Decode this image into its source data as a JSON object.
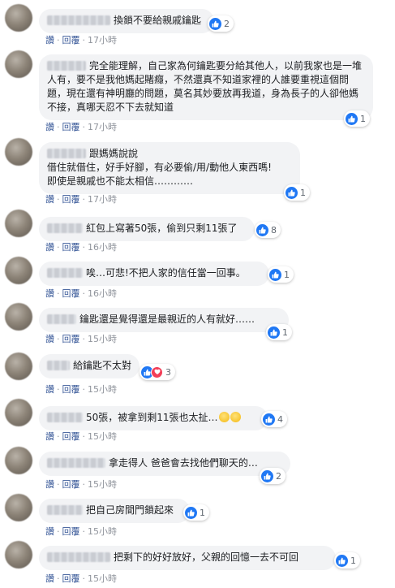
{
  "labels": {
    "like": "讚",
    "reply": "回覆",
    "separator": "·"
  },
  "colors": {
    "link": "#385898",
    "like": "#2078f4",
    "love": "#f33e58",
    "bubble": "#f2f3f5"
  },
  "comments": [
    {
      "text": "換鎖不要給親戚鑰匙",
      "reactions": "2",
      "time": "17小時",
      "emoji": []
    },
    {
      "text": "完全能理解，自己家為何鑰匙要分給其他人，以前我家也是一堆人有，要不是我他媽起賭癮，不然還真不知道家裡的人誰要重視這個問題，現在還有神明廳的問題，莫名其妙要放再我道，身為長子的人卻他媽不接，真哪天忍不下去就知道",
      "reactions": "1",
      "time": "17小時",
      "emoji": []
    },
    {
      "text": "跟媽媽說說\n借住就借住，好手好腳，有必要偷/用/動他人東西嗎!\n即使是親戚也不能太相信…………",
      "reactions": "1",
      "time": "17小時",
      "emoji": []
    },
    {
      "text": "紅包上寫著50張，偷到只剩11張了",
      "reactions": "8",
      "time": "16小時",
      "emoji": []
    },
    {
      "text": "唉…可悲!不把人家的信任當一回事。",
      "reactions": "1",
      "time": "16小時",
      "emoji": []
    },
    {
      "text": "鑰匙還是覺得還是最親近的人有就好……",
      "reactions": "1",
      "time": "15小時",
      "emoji": []
    },
    {
      "text": "給鑰匙不太對",
      "reactions": "3",
      "time": "15小時",
      "emoji": []
    },
    {
      "text": "50張，被拿到剩11張也太扯…",
      "reactions": "4",
      "time": "15小時",
      "emoji": [
        "smile-emoji",
        "smile-emoji"
      ]
    },
    {
      "text": "拿走得人 爸爸會去找他們聊天的…",
      "reactions": "2",
      "time": "15小時",
      "emoji": []
    },
    {
      "text": "把自己房間門鎖起來",
      "reactions": "1",
      "time": "15小時",
      "emoji": []
    },
    {
      "text": "把剩下的好好放好，父親的回憶一去不可回",
      "reactions": "1",
      "time": "15小時",
      "emoji": []
    }
  ]
}
